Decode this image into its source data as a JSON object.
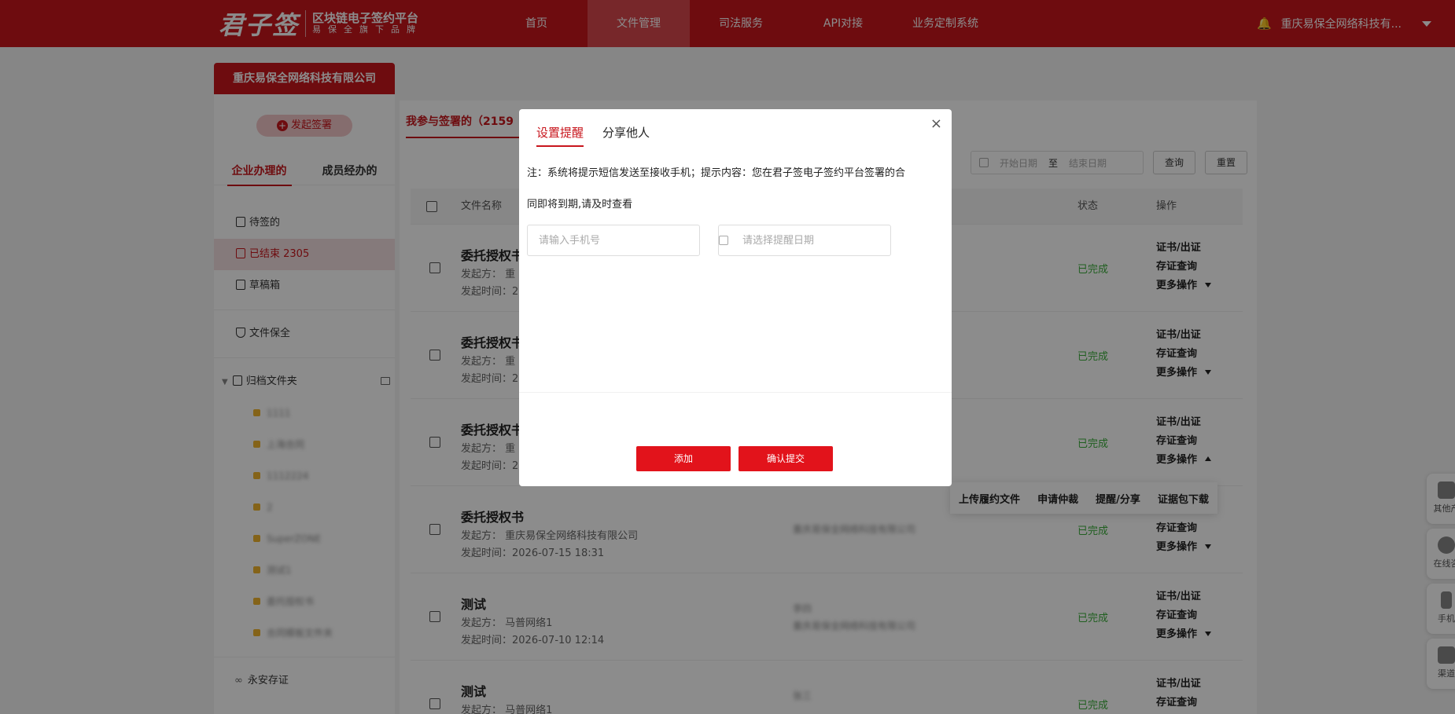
{
  "header": {
    "logo_main": "君子签",
    "logo_line1": "区块链电子签约平台",
    "logo_line2": "易保全旗下品牌",
    "nav": [
      "首页",
      "文件管理",
      "司法服务",
      "API对接",
      "业务定制系统"
    ],
    "active_nav": "文件管理",
    "company": "重庆易保全网络科技有..."
  },
  "sidebar": {
    "company_tab": "重庆易保全网络科技有限公司",
    "start_sign": "发起签署",
    "tabs": [
      "企业办理的",
      "成员经办的"
    ],
    "items": {
      "pending": "待签的",
      "finished": "已结束 2305",
      "drafts": "草稿箱",
      "preservation": "文件保全",
      "archive": "归档文件夹",
      "forever": "永安存证"
    },
    "folders": [
      "1111",
      "上海合同",
      "1112224",
      "2",
      "SuperZONE",
      "测试1",
      "委托授权书",
      "合同模板文件夹"
    ]
  },
  "main": {
    "tab": "我参与签署的（2159",
    "date_start": "开始日期",
    "date_to": "至",
    "date_end": "结束日期",
    "query": "查询",
    "reset": "重置",
    "col_name": "文件名称",
    "col_status": "状态",
    "col_ops": "操作",
    "rows": [
      {
        "name": "委托授权书",
        "initiator": "发起方：  重",
        "time": "发起时间：2",
        "parties": "",
        "status": "已完成",
        "op1": "证书/出证",
        "op2": "存证查询",
        "op3": "更多操作"
      },
      {
        "name": "委托授权书",
        "initiator": "发起方：  重",
        "time": "发起时间：2",
        "parties": "",
        "status": "已完成",
        "op1": "证书/出证",
        "op2": "存证查询",
        "op3": "更多操作"
      },
      {
        "name": "委托授权书",
        "initiator": "发起方：  重",
        "time": "发起时间：2",
        "parties": "",
        "status": "已完成",
        "op1": "证书/出证",
        "op2": "存证查询",
        "op3": "更多操作"
      },
      {
        "name": "委托授权书",
        "initiator": "发起方：  重庆易保全网络科技有限公司",
        "time": "发起时间：2026-07-15 18:31",
        "parties": "重庆易保全网络科技有限公司",
        "status": "已完成",
        "op1": "证书/出证",
        "op2": "存证查询",
        "op3": "更多操作"
      },
      {
        "name": "测试",
        "initiator": "发起方：  马普网络1",
        "time": "发起时间：2026-07-10 12:14",
        "parties": "李四",
        "parties2": "重庆易保全网络科技有限公司",
        "status": "已完成",
        "op1": "证书/出证",
        "op2": "存证查询",
        "op3": "更多操作"
      },
      {
        "name": "测试",
        "initiator": "发起方：  马普网络1",
        "time": "",
        "parties": "张三",
        "status": "已完成",
        "op1": "证书/出证",
        "op2": "存证查询",
        "op3": ""
      }
    ],
    "popover": [
      "上传履约文件",
      "申请仲裁",
      "提醒/分享",
      "证据包下载"
    ]
  },
  "float_tools": [
    "其他产",
    "在线咨",
    "手机",
    "渠道"
  ],
  "modal": {
    "tabs": [
      "设置提醒",
      "分享他人"
    ],
    "active_tab": "设置提醒",
    "note_line1": "注：系统将提示短信发送至接收手机；提示内容：您在君子签电子签约平台签署的合",
    "note_line2": "同即将到期,请及时查看",
    "phone_placeholder": "请输入手机号",
    "date_placeholder": "请选择提醒日期",
    "add": "添加",
    "confirm": "确认提交",
    "close": "×"
  },
  "colors": {
    "brand": "#c8161d",
    "success": "#3bad3b",
    "button": "#e2131b"
  }
}
